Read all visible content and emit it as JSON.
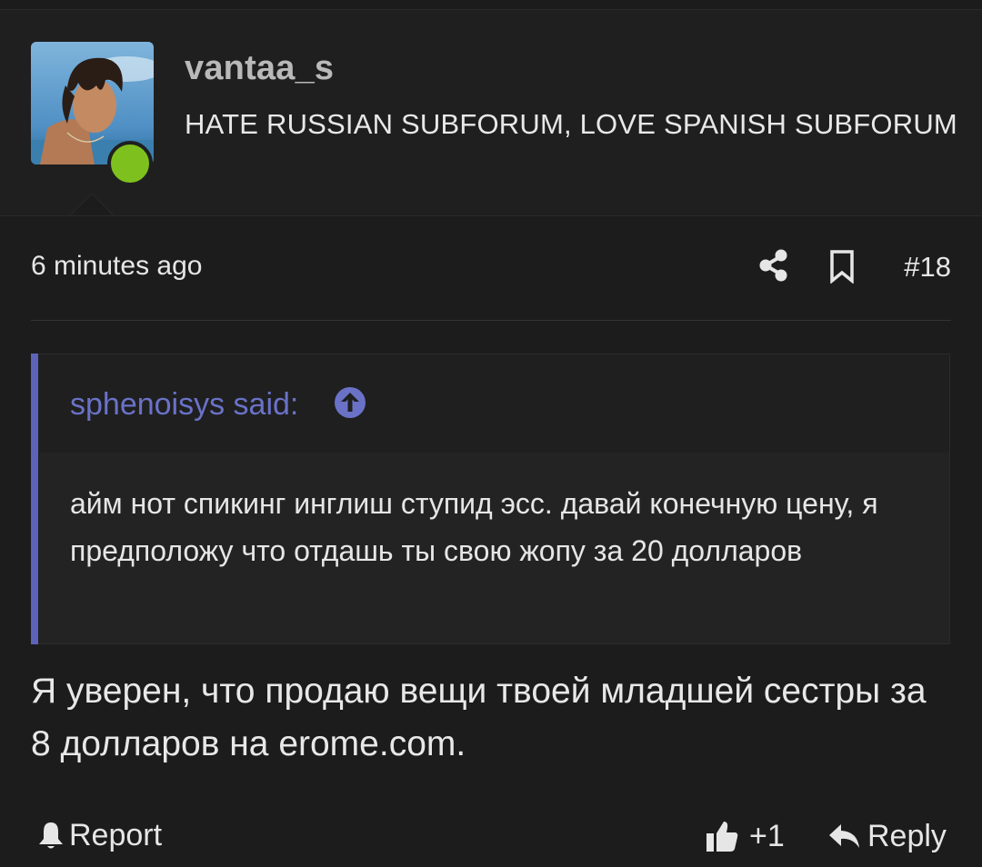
{
  "user": {
    "username": "vantaa_s",
    "title": "HATE RUSSIAN SUBFORUM, LOVE SPANISH SUBFORUM",
    "online_color": "#7ec11e"
  },
  "meta": {
    "timestamp": "6 minutes ago",
    "post_number": "#18",
    "share_icon": "share-icon",
    "bookmark_icon": "bookmark-icon"
  },
  "quote": {
    "author_line": "sphenoisys said:",
    "text": "айм нот спикинг инглиш ступид эсс. давай конечную цену, я предположу что отдашь ты свою жопу за 20 долларов",
    "accent_color": "#5c63b8"
  },
  "message": {
    "text": "Я уверен, что продаю вещи твоей младшей сестры за 8 долларов на erome.com."
  },
  "actions": {
    "report_label": "Report",
    "like_count": "+1",
    "reply_label": "Reply"
  }
}
